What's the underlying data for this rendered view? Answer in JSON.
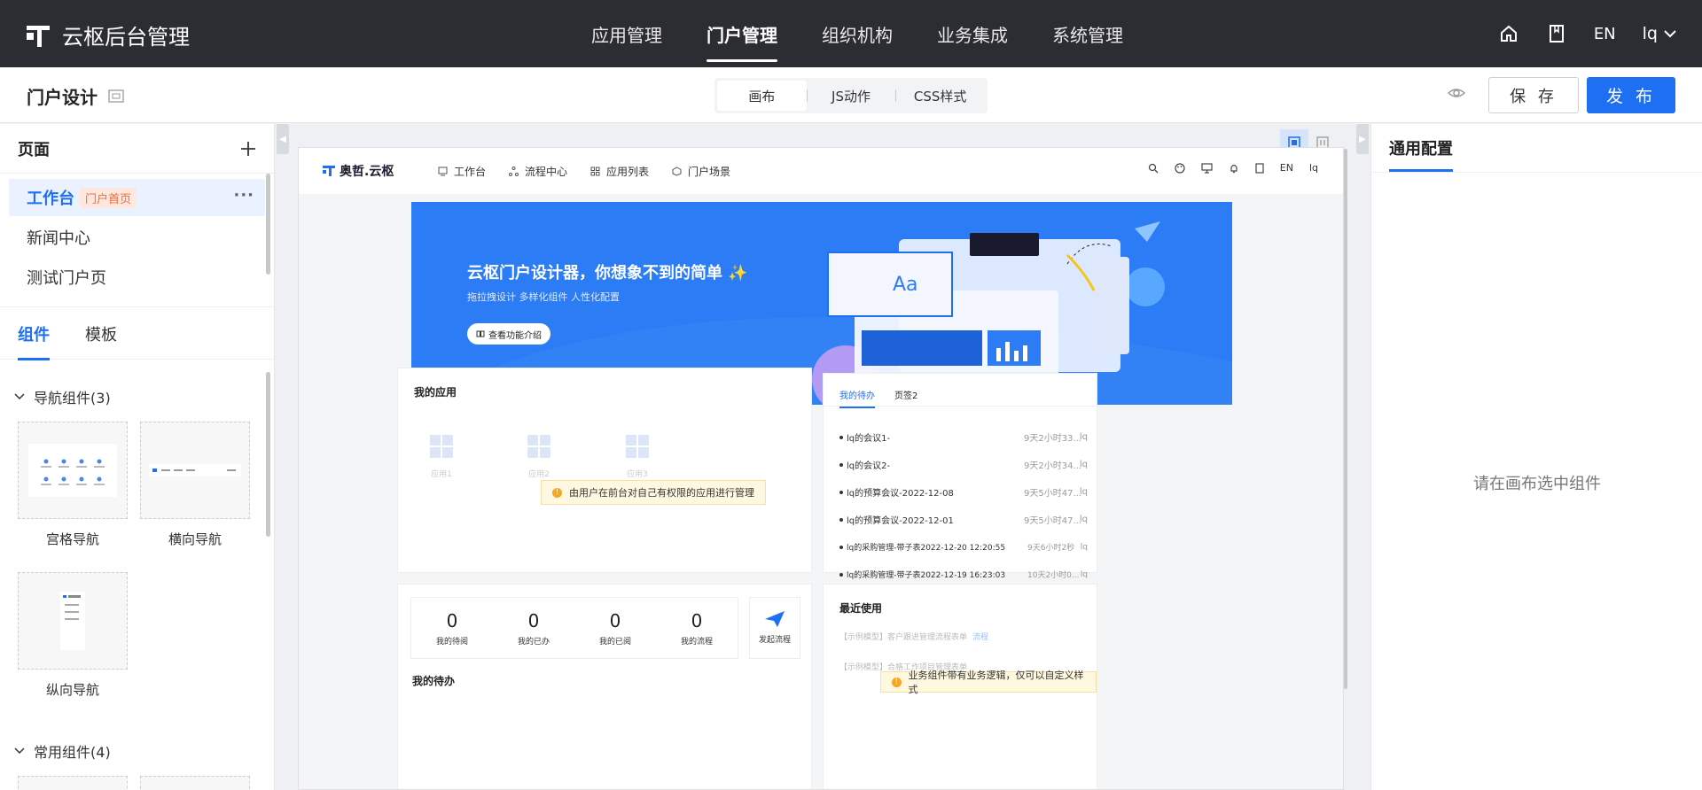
{
  "app": {
    "title": "云枢后台管理"
  },
  "mainnav": [
    {
      "label": "应用管理"
    },
    {
      "label": "门户管理"
    },
    {
      "label": "组织机构"
    },
    {
      "label": "业务集成"
    },
    {
      "label": "系统管理"
    }
  ],
  "topright": {
    "lang": "EN",
    "user": "lq"
  },
  "subbar": {
    "title": "门户设计",
    "segments": [
      {
        "label": "画布"
      },
      {
        "label": "JS动作"
      },
      {
        "label": "CSS样式"
      }
    ],
    "save": "保 存",
    "publish": "发 布"
  },
  "pages": {
    "header": "页面",
    "items": [
      {
        "label": "工作台",
        "tag": "门户首页"
      },
      {
        "label": "新闻中心"
      },
      {
        "label": "测试门户页"
      }
    ]
  },
  "lefttabs": [
    {
      "label": "组件"
    },
    {
      "label": "模板"
    }
  ],
  "groups": {
    "nav": {
      "title": "导航组件",
      "count": "(3)"
    },
    "common": {
      "title": "常用组件",
      "count": "(4)"
    }
  },
  "components": [
    {
      "label": "宫格导航"
    },
    {
      "label": "横向导航"
    },
    {
      "label": "纵向导航"
    }
  ],
  "preview": {
    "logo": "奥哲.云枢",
    "nav": [
      {
        "label": "工作台"
      },
      {
        "label": "流程中心"
      },
      {
        "label": "应用列表"
      },
      {
        "label": "门户场景"
      }
    ],
    "lang": "EN",
    "user": "lq",
    "banner": {
      "title": "云枢门户设计器，你想象不到的简单 ✨",
      "subtitle": "拖拉拽设计   多样化组件   人性化配置",
      "button": "查看功能介绍",
      "aa": "Aa"
    },
    "myapps": {
      "title": "我的应用",
      "apps": [
        "应用1",
        "应用2",
        "应用3"
      ],
      "tip": "由用户在前台对自己有权限的应用进行管理"
    },
    "todo": {
      "tabs": [
        "我的待办",
        "页签2"
      ],
      "rows": [
        {
          "title": "lq的会议1-",
          "time": "9天2小时33...",
          "user": "lq"
        },
        {
          "title": "lq的会议2-",
          "time": "9天2小时34...",
          "user": "lq"
        },
        {
          "title": "lq的预算会议-2022-12-08",
          "time": "9天5小时47...",
          "user": "lq"
        },
        {
          "title": "lq的预算会议-2022-12-01",
          "time": "9天5小时47...",
          "user": "lq"
        },
        {
          "title": "lq的采购管理-带子表2022-12-20 12:20:55",
          "time": "9天6小时2秒",
          "user": "lq"
        },
        {
          "title": "lq的采购管理-带子表2022-12-19 16:23:03",
          "time": "10天2小时0...",
          "user": "lq"
        }
      ]
    },
    "stats": [
      {
        "value": "0",
        "label": "我的待阅"
      },
      {
        "value": "0",
        "label": "我的已办"
      },
      {
        "value": "0",
        "label": "我的已阅"
      },
      {
        "value": "0",
        "label": "我的流程"
      }
    ],
    "start": "发起流程",
    "mytodo": "我的待办",
    "recent": {
      "title": "最近使用",
      "rows": [
        "【示例模型】客户跟进管理流程表单",
        "【示例模型】合格工作项目管理表单"
      ],
      "tag": "流程",
      "tip": "业务组件带有业务逻辑，仅可以自定义样式"
    }
  },
  "rightpanel": {
    "tab": "通用配置",
    "empty": "请在画布选中组件"
  },
  "colors": {
    "primary": "#1f6ff2",
    "topbar": "#2b2d33",
    "banner": "#2b7cf5"
  }
}
